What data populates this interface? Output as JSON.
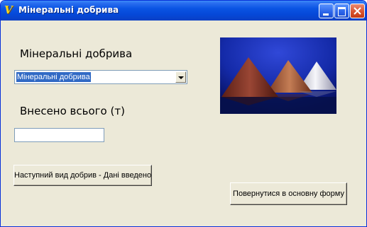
{
  "window": {
    "title": "Мінеральні добрива",
    "app_icon_glyph": "V"
  },
  "form": {
    "fertilizer_label": "Мінеральні добрива",
    "fertilizer_select_value": "Мінеральні добрива",
    "total_label": "Внесено всього (т)",
    "total_input_value": ""
  },
  "buttons": {
    "next": "Наступний вид добрив - Дані введено",
    "back": "Повернутися в основну форму"
  },
  "image": {
    "subject": "three heaps of fertilizer granules",
    "colors": [
      "#8a3b2a",
      "#b36a45",
      "#e8e8ee"
    ],
    "background": "#0c1a8a"
  }
}
